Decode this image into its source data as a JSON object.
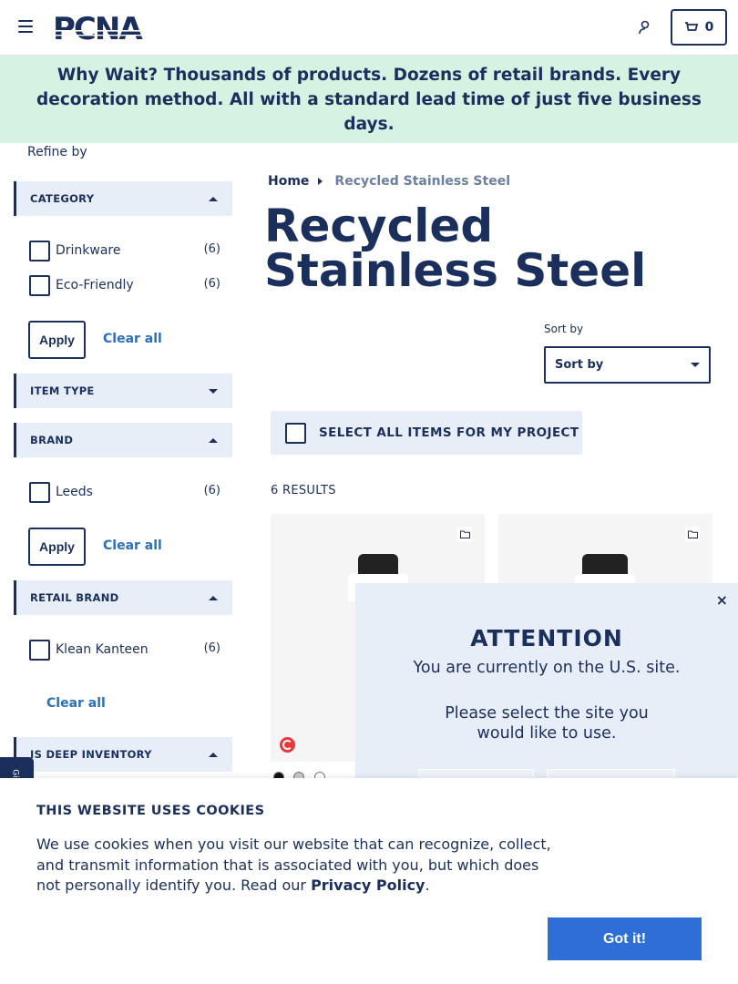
{
  "header": {
    "logo_text": "PCNA",
    "cart_count": "0"
  },
  "banner": {
    "lead": "Why Wait?",
    "message": "Thousands of products. Dozens of retail brands. Every decoration method. All with a standard lead time of just five business days."
  },
  "sidebar": {
    "refine_label": "Refine by",
    "facets": {
      "category": {
        "label": "CATEGORY",
        "options": [
          {
            "label": "Drinkware",
            "count": "(6)"
          },
          {
            "label": "Eco-Friendly",
            "count": "(6)"
          }
        ],
        "apply_label": "Apply",
        "clear_label": "Clear all"
      },
      "item_type": {
        "label": "ITEM TYPE"
      },
      "brand": {
        "label": "BRAND",
        "options": [
          {
            "label": "Leeds",
            "count": "(6)"
          }
        ],
        "apply_label": "Apply",
        "clear_label": "Clear all"
      },
      "retail_brand": {
        "label": "RETAIL BRAND",
        "options": [
          {
            "label": "Klean Kanteen",
            "count": "(6)"
          }
        ],
        "clear_label": "Clear all"
      },
      "deep_inventory": {
        "label": "IS DEEP INVENTORY"
      }
    }
  },
  "main": {
    "breadcrumb": {
      "home": "Home",
      "current": "Recycled Stainless Steel"
    },
    "title": "Recycled Stainless Steel",
    "sort": {
      "label": "Sort by",
      "value": "Sort by"
    },
    "select_all_label": "SELECT ALL ITEMS FOR MY PROJECT",
    "results_count": "6 RESULTS",
    "swatch_colors": [
      "#111111",
      "#c8c8c8",
      "#ffffff"
    ]
  },
  "modal": {
    "title": "ATTENTION",
    "subtitle": "You are currently on the U.S. site.",
    "body": "Please select the site you would like to use.",
    "close": "×"
  },
  "feedback_tab": "Gi",
  "cookie": {
    "title": "THIS WEBSITE USES COOKIES",
    "text": "We use cookies when you visit our website that can recognize, collect, and transmit information that is associated with you, but which does not personally identify you. Read our",
    "link": "Privacy Policy",
    "button": "Got it!"
  },
  "colors": {
    "brand_navy": "#1b2f5c",
    "banner_bg": "#d5f3e2",
    "link_blue": "#2d6fb8",
    "cta_blue": "#2d6fd6"
  }
}
